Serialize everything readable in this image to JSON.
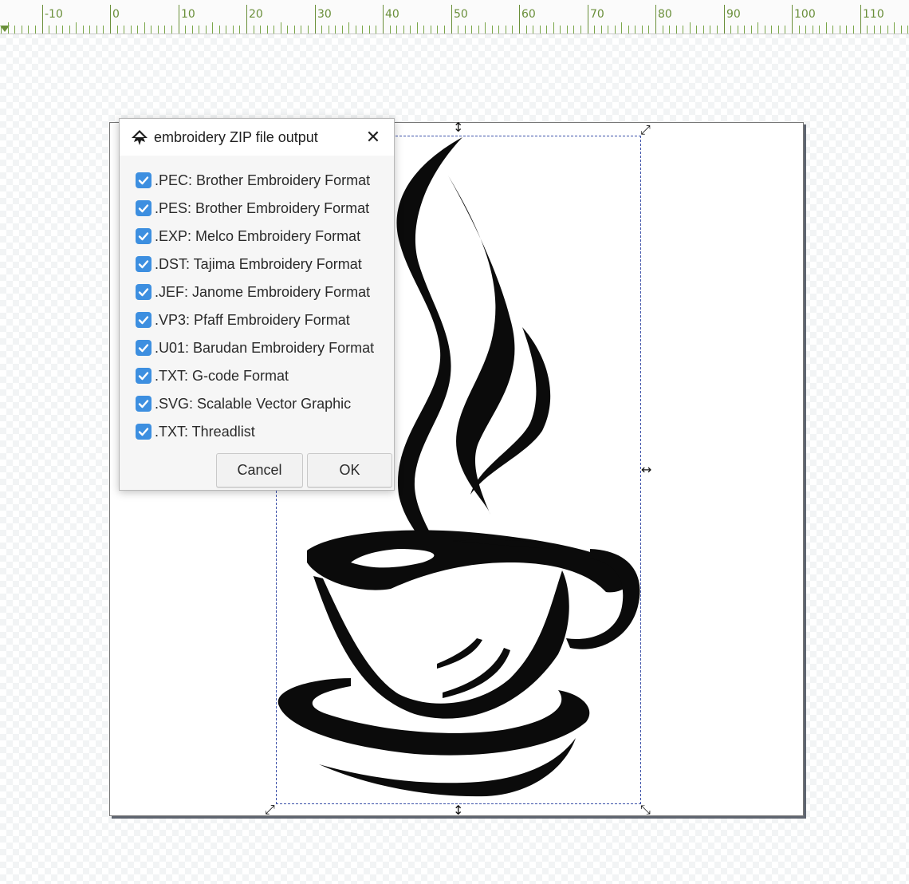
{
  "ruler": {
    "labels": [
      "-10",
      "0",
      "10",
      "20",
      "30",
      "40",
      "50",
      "60",
      "70",
      "80",
      "90",
      "100",
      "110"
    ],
    "accent_color": "#6a8f3a"
  },
  "canvas": {
    "artwork_icon": "coffee-cup-icon",
    "selection_color": "#3a4fa8"
  },
  "dialog": {
    "title": "embroidery ZIP file output",
    "app_icon": "inkscape-logo-icon",
    "close_glyph": "✕",
    "options": [
      {
        "label": ".PEC: Brother Embroidery Format",
        "checked": true
      },
      {
        "label": ".PES: Brother Embroidery Format",
        "checked": true
      },
      {
        "label": ".EXP: Melco Embroidery Format",
        "checked": true
      },
      {
        "label": ".DST: Tajima Embroidery Format",
        "checked": true
      },
      {
        "label": ".JEF: Janome Embroidery Format",
        "checked": true
      },
      {
        "label": ".VP3: Pfaff Embroidery Format",
        "checked": true
      },
      {
        "label": ".U01: Barudan Embroidery Format",
        "checked": true
      },
      {
        "label": ".TXT: G-code Format",
        "checked": true
      },
      {
        "label": ".SVG: Scalable Vector Graphic",
        "checked": true
      },
      {
        "label": ".TXT: Threadlist",
        "checked": true
      }
    ],
    "checkbox_color": "#3d8fe0",
    "cancel_label": "Cancel",
    "ok_label": "OK"
  }
}
